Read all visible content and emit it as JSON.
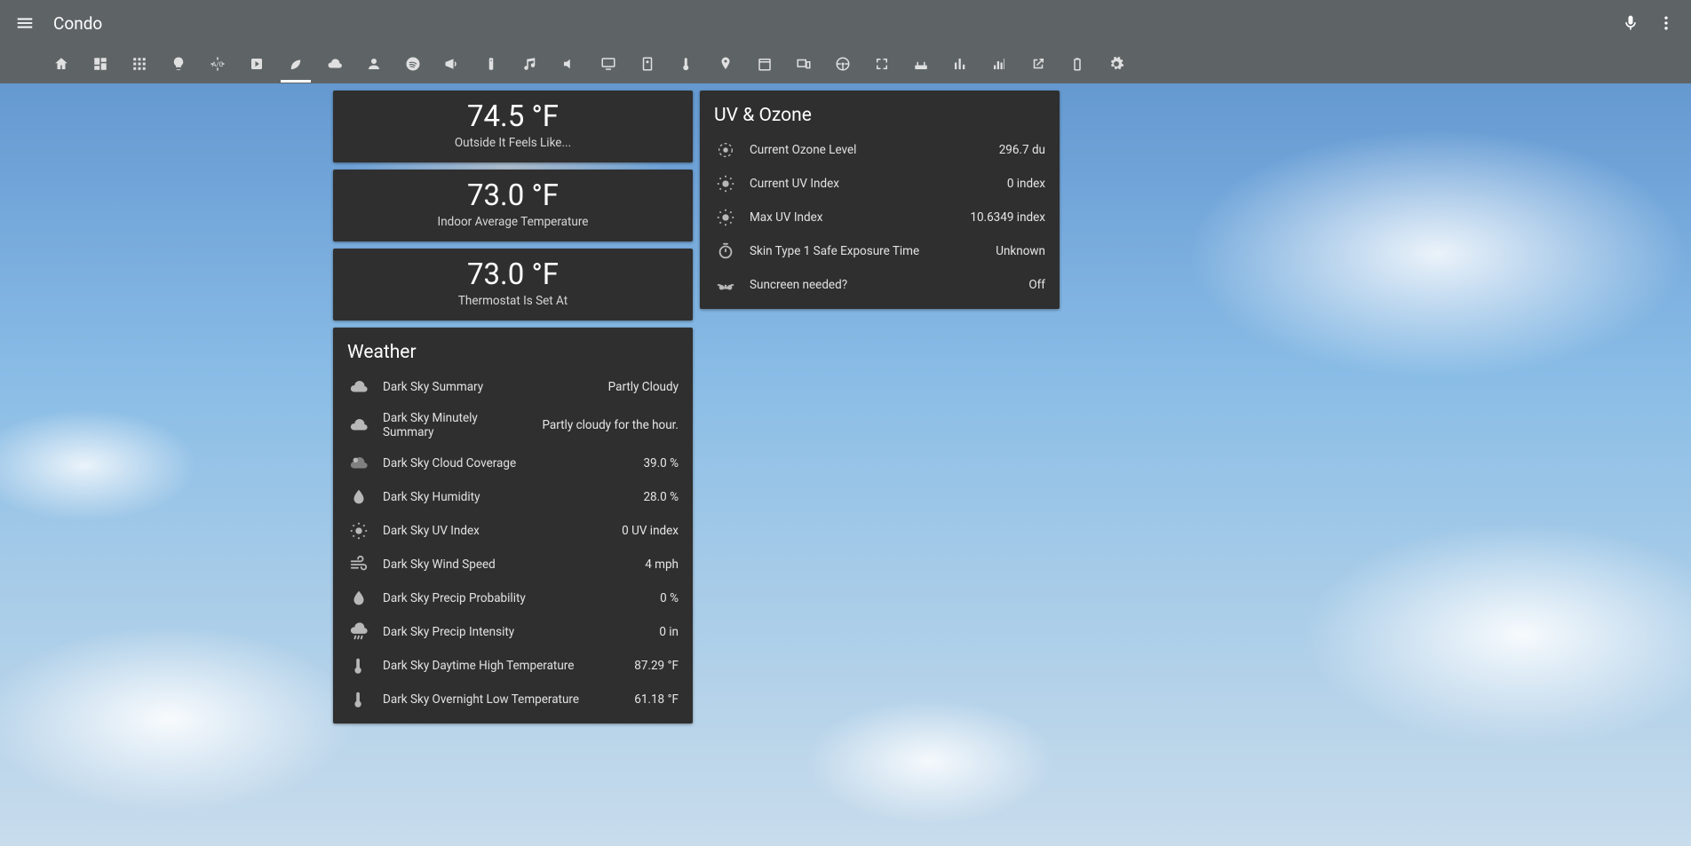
{
  "header": {
    "title": "Condo"
  },
  "tabs": [
    {
      "name": "home-icon"
    },
    {
      "name": "dashboard-icon"
    },
    {
      "name": "grid-icon"
    },
    {
      "name": "lightbulb-icon"
    },
    {
      "name": "ac-icon"
    },
    {
      "name": "player-icon"
    },
    {
      "name": "leaf-icon",
      "active": true
    },
    {
      "name": "cloud-icon"
    },
    {
      "name": "person-icon"
    },
    {
      "name": "spotify-icon"
    },
    {
      "name": "megaphone-icon"
    },
    {
      "name": "remote-icon"
    },
    {
      "name": "music-icon"
    },
    {
      "name": "volume-icon"
    },
    {
      "name": "monitor-icon"
    },
    {
      "name": "appliance-icon"
    },
    {
      "name": "thermometer-icon"
    },
    {
      "name": "map-icon"
    },
    {
      "name": "calendar-icon"
    },
    {
      "name": "devices-icon"
    },
    {
      "name": "steering-icon"
    },
    {
      "name": "fullscreen-icon"
    },
    {
      "name": "router-icon"
    },
    {
      "name": "stats-icon"
    },
    {
      "name": "chart-icon"
    },
    {
      "name": "openlink-icon"
    },
    {
      "name": "battery-icon"
    },
    {
      "name": "gear-icon"
    }
  ],
  "sensors": {
    "outside": {
      "value": "74.5 °F",
      "label": "Outside It Feels Like..."
    },
    "indoor": {
      "value": "73.0 °F",
      "label": "Indoor Average Temperature"
    },
    "thermo": {
      "value": "73.0 °F",
      "label": "Thermostat Is Set At"
    }
  },
  "weather": {
    "title": "Weather",
    "rows": [
      {
        "icon": "cloud",
        "label": "Dark Sky Summary",
        "value": "Partly Cloudy"
      },
      {
        "icon": "cloud",
        "label": "Dark Sky Minutely Summary",
        "value": "Partly cloudy for the hour."
      },
      {
        "icon": "coverage",
        "label": "Dark Sky Cloud Coverage",
        "value": "39.0 %"
      },
      {
        "icon": "droplet",
        "label": "Dark Sky Humidity",
        "value": "28.0 %"
      },
      {
        "icon": "sun",
        "label": "Dark Sky UV Index",
        "value": "0 UV index"
      },
      {
        "icon": "wind",
        "label": "Dark Sky Wind Speed",
        "value": "4 mph"
      },
      {
        "icon": "droplet",
        "label": "Dark Sky Precip Probability",
        "value": "0 %"
      },
      {
        "icon": "rain",
        "label": "Dark Sky Precip Intensity",
        "value": "0 in"
      },
      {
        "icon": "thermo",
        "label": "Dark Sky Daytime High Temperature",
        "value": "87.29 °F"
      },
      {
        "icon": "thermo",
        "label": "Dark Sky Overnight Low Temperature",
        "value": "61.18 °F"
      }
    ]
  },
  "uv": {
    "title": "UV & Ozone",
    "rows": [
      {
        "icon": "ozone",
        "label": "Current Ozone Level",
        "value": "296.7 du"
      },
      {
        "icon": "sun",
        "label": "Current UV Index",
        "value": "0 index"
      },
      {
        "icon": "sun",
        "label": "Max UV Index",
        "value": "10.6349 index"
      },
      {
        "icon": "timer",
        "label": "Skin Type 1 Safe Exposure Time",
        "value": "Unknown"
      },
      {
        "icon": "glasses",
        "label": "Suncreen needed?",
        "value": "Off"
      }
    ]
  }
}
